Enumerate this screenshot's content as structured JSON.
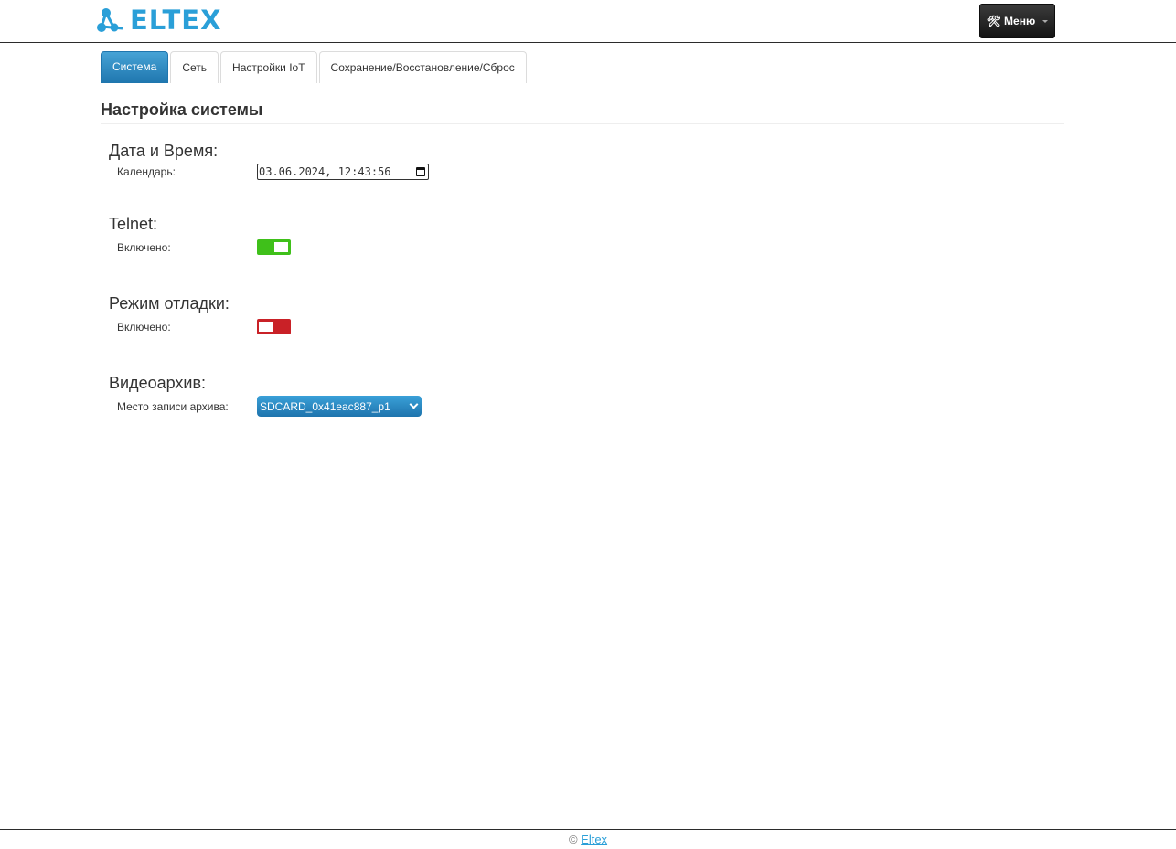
{
  "header": {
    "logo_text": "ELTEX",
    "menu_label": "Меню",
    "menu_icon": "tools-icon",
    "brand_color": "#2a9fd8"
  },
  "tabs": [
    {
      "label": "Система",
      "active": true
    },
    {
      "label": "Сеть",
      "active": false
    },
    {
      "label": "Настройки IoT",
      "active": false
    },
    {
      "label": "Сохранение/Восстановление/Сброс",
      "active": false
    }
  ],
  "page": {
    "title": "Настройка системы"
  },
  "datetime": {
    "heading": "Дата и Время:",
    "label": "Календарь:",
    "value": "03.06.2024, 12:43:56"
  },
  "telnet": {
    "heading": "Telnet:",
    "label": "Включено:",
    "enabled": true,
    "color": "#3fc01a"
  },
  "debug": {
    "heading": "Режим отладки:",
    "label": "Включено:",
    "enabled": false,
    "color": "#c92127"
  },
  "archive": {
    "heading": "Видеоархив:",
    "label": "Место записи архива:",
    "selected": "SDCARD_0x41eac887_p1"
  },
  "footer": {
    "copyright": "©",
    "link_text": "Eltex"
  }
}
